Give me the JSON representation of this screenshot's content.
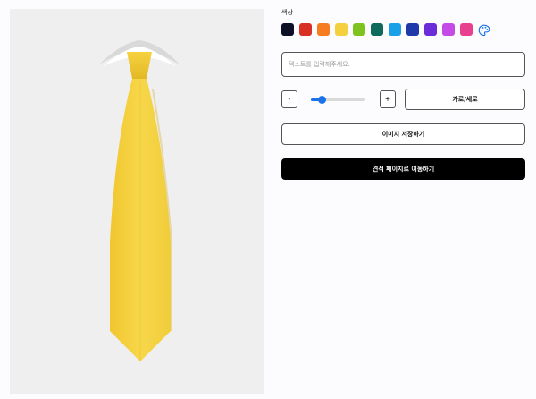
{
  "controls": {
    "color_label": "색상",
    "swatches": [
      {
        "name": "navy",
        "color": "#0d1026"
      },
      {
        "name": "red",
        "color": "#d93025"
      },
      {
        "name": "orange",
        "color": "#f57c1f"
      },
      {
        "name": "yellow",
        "color": "#f4d03f"
      },
      {
        "name": "lime",
        "color": "#7ec31f"
      },
      {
        "name": "teal",
        "color": "#0e6b5c"
      },
      {
        "name": "sky",
        "color": "#1aa0e6"
      },
      {
        "name": "blue",
        "color": "#1f3aa8"
      },
      {
        "name": "violet",
        "color": "#6b2bd9"
      },
      {
        "name": "magenta",
        "color": "#c54be6"
      },
      {
        "name": "pink",
        "color": "#e8408f"
      }
    ],
    "palette_icon": "palette-icon",
    "text_input_placeholder": "텍스트를 입력해주세요.",
    "decrease_label": "-",
    "increase_label": "+",
    "size_slider_value": 0.2,
    "orientation_label": "가로/세로",
    "save_image_label": "이미지 저장하기",
    "estimate_label": "견적 페이지로 이동하기"
  },
  "preview": {
    "tie_color": "#f4d03f"
  }
}
